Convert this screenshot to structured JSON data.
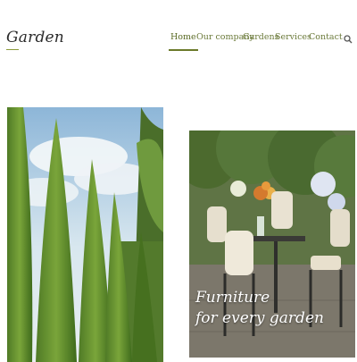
{
  "header": {
    "logo": "Garden",
    "nav": [
      {
        "label": "Home",
        "active": true
      },
      {
        "label": "Our company",
        "active": false
      },
      {
        "label": "Gardens",
        "active": false
      },
      {
        "label": "Services",
        "active": false
      },
      {
        "label": "Contact",
        "active": false
      }
    ],
    "search_icon": "search-icon"
  },
  "gallery": {
    "left_image": "topiary-garden",
    "right_image": "garden-furniture",
    "caption_line1": "Furniture",
    "caption_line2": "for every garden"
  },
  "colors": {
    "accent": "#6b7a2a",
    "nav_text": "#6b7a3a",
    "logo_text": "#2a2a2a"
  }
}
